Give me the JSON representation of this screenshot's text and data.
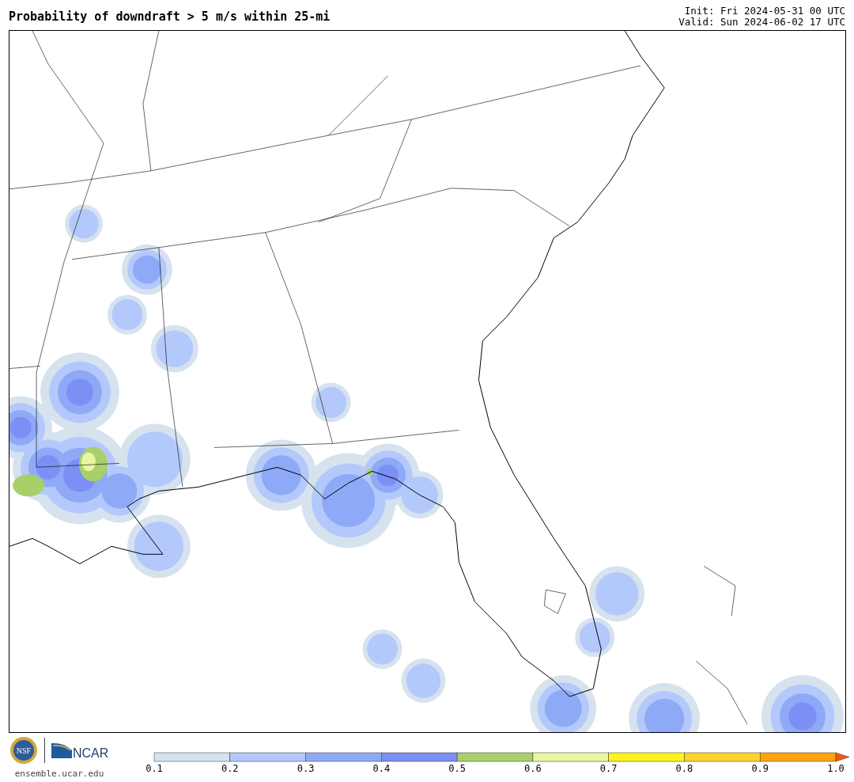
{
  "title": "Probability of downdraft > 5 m/s within 25-mi",
  "init": "Init: Fri 2024-05-31 00 UTC",
  "valid": "Valid: Sun 2024-06-02 17 UTC",
  "logos": {
    "nsf": "NSF",
    "ncar": "NCAR"
  },
  "site": "ensemble.ucar.edu",
  "legend": {
    "bins": [
      {
        "color": "#d6e2ee"
      },
      {
        "color": "#b4c9fb"
      },
      {
        "color": "#8eaaf7"
      },
      {
        "color": "#7b8ff5"
      },
      {
        "color": "#a8cf6a"
      },
      {
        "color": "#e8f5a2"
      },
      {
        "color": "#fcf41a"
      },
      {
        "color": "#fdd22a"
      },
      {
        "color": "#fca510"
      }
    ],
    "extend_arrow": {
      "color": "#f35a0c"
    },
    "ticks": [
      "0.1",
      "0.2",
      "0.3",
      "0.4",
      "0.5",
      "0.6",
      "0.7",
      "0.8",
      "0.9",
      "1.0"
    ]
  }
}
